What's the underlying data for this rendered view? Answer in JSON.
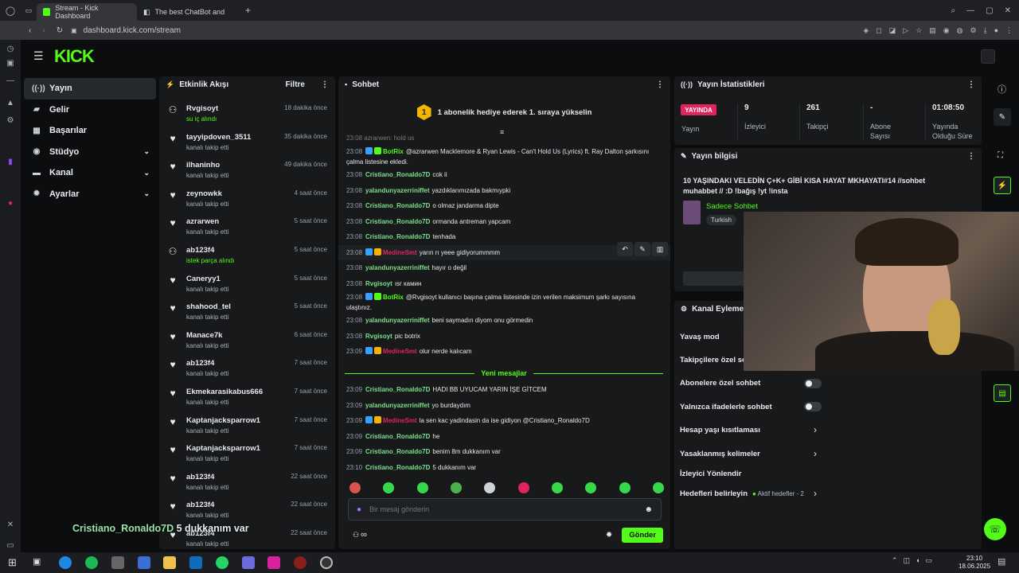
{
  "browser": {
    "tabs": [
      {
        "label": "Stream - Kick Dashboard",
        "active": true
      },
      {
        "label": "The best ChatBot and",
        "active": false
      }
    ],
    "url": "dashboard.kick.com/stream"
  },
  "brand": {
    "logo": "KICK",
    "accent": "#53fc18"
  },
  "sidebar": {
    "items": [
      {
        "label": "Yayın",
        "icon": "broadcast-icon",
        "active": true
      },
      {
        "label": "Gelir",
        "icon": "wallet-icon"
      },
      {
        "label": "Başarılar",
        "icon": "trophy-icon"
      },
      {
        "label": "Stüdyo",
        "icon": "studio-icon",
        "expand": true
      },
      {
        "label": "Kanal",
        "icon": "channel-icon",
        "expand": true
      },
      {
        "label": "Ayarlar",
        "icon": "gear-icon",
        "expand": true
      }
    ]
  },
  "activity": {
    "title": "Etkinlik Akışı",
    "filter": "Filtre",
    "items": [
      {
        "name": "Rvgisoyt",
        "sub": "su iç alındı",
        "time": "18 dakika önce",
        "green": true
      },
      {
        "name": "tayyipdoven_3511",
        "sub": "kanalı takip etti",
        "time": "35 dakika önce"
      },
      {
        "name": "ilhaninho",
        "sub": "kanalı takip etti",
        "time": "49 dakika önce"
      },
      {
        "name": "zeynowkk",
        "sub": "kanalı takip etti",
        "time": "4 saat önce"
      },
      {
        "name": "azrarwen",
        "sub": "kanalı takip etti",
        "time": "5 saat önce"
      },
      {
        "name": "ab123f4",
        "sub": "istek parça alındı",
        "time": "5 saat önce",
        "green": true
      },
      {
        "name": "Caneryy1",
        "sub": "kanalı takip etti",
        "time": "5 saat önce"
      },
      {
        "name": "shahood_tel",
        "sub": "kanalı takip etti",
        "time": "5 saat önce"
      },
      {
        "name": "Manace7k",
        "sub": "kanalı takip etti",
        "time": "6 saat önce"
      },
      {
        "name": "ab123f4",
        "sub": "kanalı takip etti",
        "time": "7 saat önce"
      },
      {
        "name": "Ekmekarasikabus666",
        "sub": "kanalı takip etti",
        "time": "7 saat önce"
      },
      {
        "name": "Kaptanjacksparrow1",
        "sub": "kanalı takip etti",
        "time": "7 saat önce"
      },
      {
        "name": "Kaptanjacksparrow1",
        "sub": "kanalı takip etti",
        "time": "7 saat önce"
      },
      {
        "name": "ab123f4",
        "sub": "kanalı takip etti",
        "time": "22 saat önce"
      },
      {
        "name": "ab123f4",
        "sub": "kanalı takip etti",
        "time": "22 saat önce"
      },
      {
        "name": "ab123f4",
        "sub": "kanalı takip etti",
        "time": "22 saat önce"
      }
    ]
  },
  "chat": {
    "title": "Sohbet",
    "gift_banner": "1 abonelik hediye ederek 1. sıraya yükselin",
    "gift_rank": "1",
    "top_partial": "23:08 azrarwen: hold us",
    "messages": [
      {
        "time": "23:08",
        "user": "BotRix",
        "color": "#53fc18",
        "text": "@azrarwen Macklemore & Ryan Lewis - Can't Hold Us (Lyrics) ft. Ray Dalton şarkısını çalma listesine ekledi.",
        "badges": [
          "#3aa0ff",
          "#53fc18"
        ],
        "tall": true
      },
      {
        "time": "23:08",
        "user": "Cristiano_Ronaldo7D",
        "color": "#7ee08a",
        "text": "cok ii"
      },
      {
        "time": "23:08",
        "user": "yalandunyazerriniffet",
        "color": "#7ee08a",
        "text": "yazdıklarımızada bakmıypki"
      },
      {
        "time": "23:08",
        "user": "Cristiano_Ronaldo7D",
        "color": "#7ee08a",
        "text": "o olmaz jandarma dipte"
      },
      {
        "time": "23:08",
        "user": "Cristiano_Ronaldo7D",
        "color": "#7ee08a",
        "text": "ormanda antreman yapcam"
      },
      {
        "time": "23:08",
        "user": "Cristiano_Ronaldo7D",
        "color": "#7ee08a",
        "text": "tenhada"
      },
      {
        "time": "23:08",
        "user": "MedineSmt",
        "color": "#e0245e",
        "text": "yarın rı yeee gidiyorummmm",
        "badges": [
          "#3aa0ff",
          "#f5b400"
        ],
        "hover": true
      },
      {
        "time": "23:08",
        "user": "yalandunyazerriniffet",
        "color": "#7ee08a",
        "text": "hayır o değil"
      },
      {
        "time": "23:08",
        "user": "Rvgisoyt",
        "color": "#7ee08a",
        "text": "ısr камин"
      },
      {
        "time": "23:08",
        "user": "BotRix",
        "color": "#53fc18",
        "text": "@Rvgisoyt kullanıcı başına çalma listesinde izin verilen maksimum şarkı sayısına ulaştınız.",
        "badges": [
          "#3aa0ff",
          "#53fc18"
        ],
        "tall": true
      },
      {
        "time": "23:08",
        "user": "yalandunyazerriniffet",
        "color": "#7ee08a",
        "text": "beni saymadın diyom onu görmedin"
      },
      {
        "time": "23:08",
        "user": "Rvgisoyt",
        "color": "#7ee08a",
        "text": "pic botrix"
      },
      {
        "time": "23:09",
        "user": "MedineSmt",
        "color": "#e0245e",
        "text": "olur nerde kalıcam",
        "badges": [
          "#3aa0ff",
          "#f5b400"
        ]
      }
    ],
    "new_messages_label": "Yeni mesajlar",
    "new_messages": [
      {
        "time": "23:09",
        "user": "Cristiano_Ronaldo7D",
        "color": "#7ee08a",
        "text": "HADI BB UYUCAM YARIN İŞE GİTCEM"
      },
      {
        "time": "23:09",
        "user": "yalandunyazerriniffet",
        "color": "#7ee08a",
        "text": "yo burdaydım"
      },
      {
        "time": "23:09",
        "user": "MedineSmt",
        "color": "#e0245e",
        "text": "la sen kac yadindasin da ise gidiyon @Cristiano_Ronaldo7D",
        "badges": [
          "#3aa0ff",
          "#f5b400"
        ]
      },
      {
        "time": "23:09",
        "user": "Cristiano_Ronaldo7D",
        "color": "#7ee08a",
        "text": "he"
      },
      {
        "time": "23:09",
        "user": "Cristiano_Ronaldo7D",
        "color": "#7ee08a",
        "text": "benim 8m dukkanım var"
      },
      {
        "time": "23:10",
        "user": "Cristiano_Ronaldo7D",
        "color": "#7ee08a",
        "text": "5 dukkanım var"
      }
    ],
    "input_placeholder": "Bir mesaj gönderin",
    "send_label": "Gönder",
    "infinity": "∞"
  },
  "stats": {
    "title": "Yayın İstatistikleri",
    "live_badge": "YAYINDA",
    "live_label": "Yayın",
    "cells": [
      {
        "value": "9",
        "label": "İzleyici"
      },
      {
        "value": "261",
        "label": "Takipçi"
      },
      {
        "value": "-",
        "label": "Abone Sayısı"
      },
      {
        "value": "01:08:50",
        "label": "Yayında Olduğu Süre"
      }
    ]
  },
  "stream_info": {
    "title": "Yayın bilgisi",
    "stream_title": "10 YAŞINDAKI VELEDİN Ç+K+ GİBİ KISA HAYAT MKHAYATI#14 //sohbet muhabbet // :D !bağış !yt !insta",
    "category": "Sadece Sohbet",
    "tag": "Turkish"
  },
  "channel_actions": {
    "title": "Kanal Eylemeri",
    "rows": [
      {
        "label": "Yavaş mod"
      },
      {
        "label": "Takipçilere özel so"
      },
      {
        "label": "Abonelere özel sohbet",
        "toggle": true
      },
      {
        "label": "Yalnızca ifadelerle sohbet",
        "toggle": true
      },
      {
        "label": "Hesap yaşı kısıtlaması",
        "arrow": true
      },
      {
        "label": "Yasaklanmış kelimeler",
        "arrow": true
      },
      {
        "label": "İzleyici Yönlendir"
      },
      {
        "label": "Hedefleri belirleyin",
        "arrow": true,
        "extra": "Aktif hedefler - 2"
      }
    ]
  },
  "overlay_caption": {
    "user": "Cristiano_Ronaldo7D",
    "text": "5 dukkanım var"
  },
  "taskbar": {
    "time": "23:10",
    "date": "18.06.2025"
  }
}
